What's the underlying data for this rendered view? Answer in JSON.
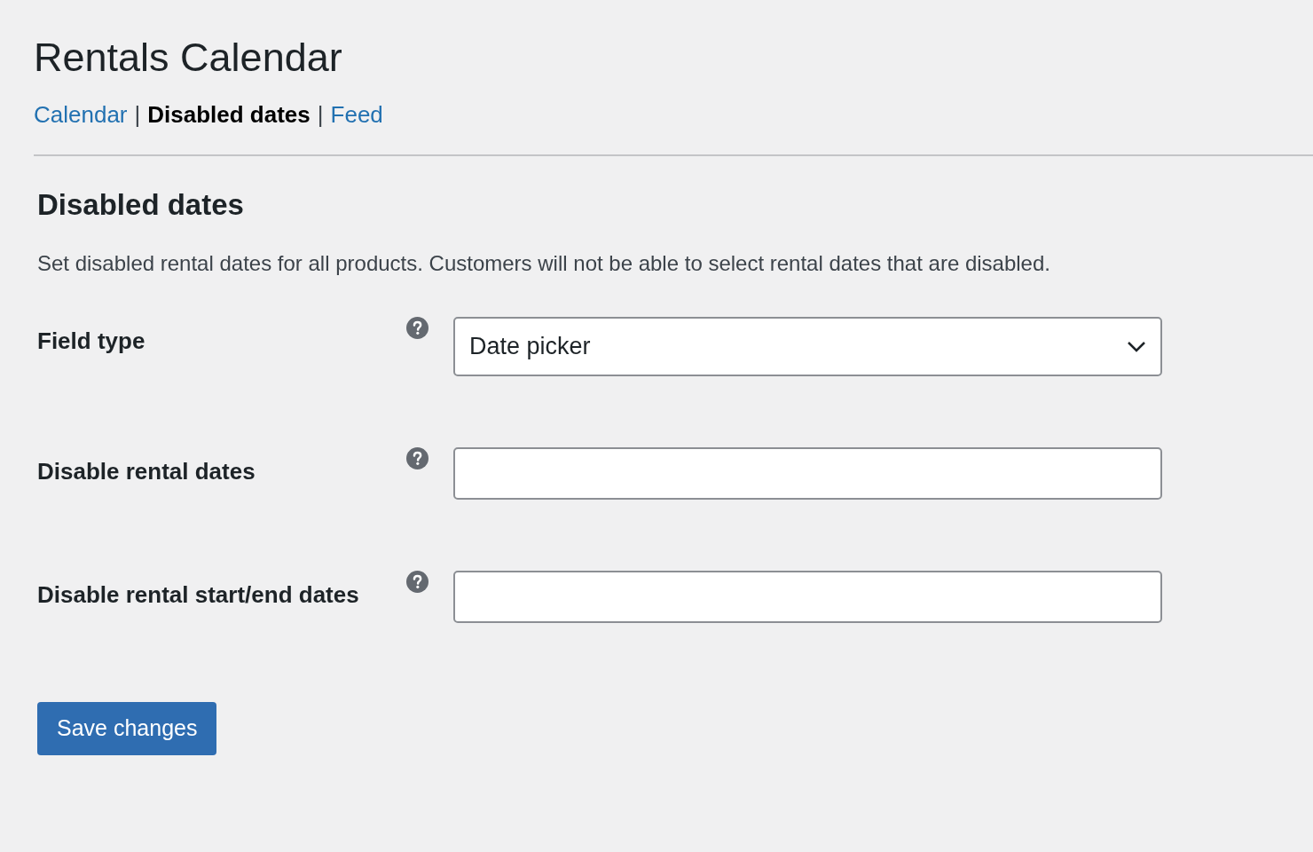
{
  "page_title": "Rentals Calendar",
  "nav": [
    {
      "label": "Calendar",
      "selected": false
    },
    {
      "label": "Disabled dates",
      "selected": true
    },
    {
      "label": "Feed",
      "selected": false
    }
  ],
  "nav_separator": "|",
  "section": {
    "heading": "Disabled dates",
    "description": "Set disabled rental dates for all products. Customers will not be able to select rental dates that are disabled."
  },
  "fields": [
    {
      "label": "Field type",
      "kind": "select",
      "value": "Date picker"
    },
    {
      "label": "Disable rental dates",
      "kind": "text"
    },
    {
      "label": "Disable rental start/end dates",
      "kind": "text"
    }
  ],
  "save_button": "Save changes"
}
